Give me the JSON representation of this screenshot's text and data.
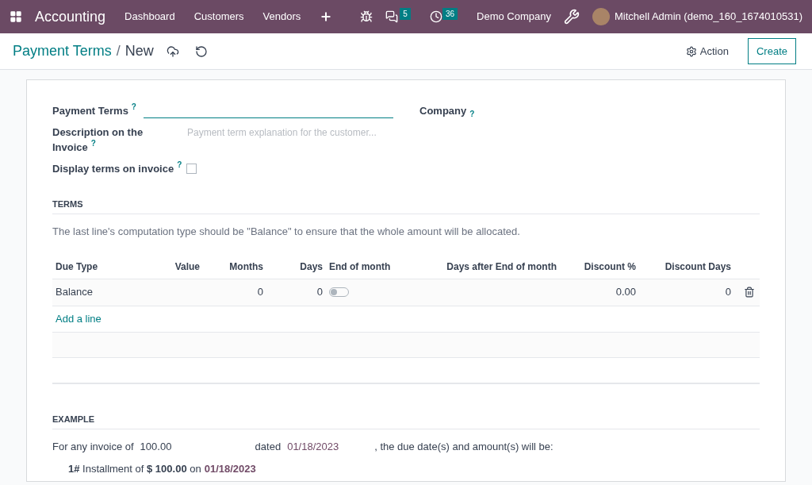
{
  "navbar": {
    "app": "Accounting",
    "menu": [
      "Dashboard",
      "Customers",
      "Vendors"
    ],
    "messages_count": "5",
    "activities_count": "36",
    "company": "Demo Company",
    "user": "Mitchell Admin (demo_160_1674010531)"
  },
  "breadcrumb": {
    "parent": "Payment Terms",
    "separator": "/",
    "current": "New"
  },
  "actions": {
    "action": "Action",
    "create": "Create"
  },
  "form": {
    "payment_terms_label": "Payment Terms",
    "description_label": "Description on the Invoice",
    "description_placeholder": "Payment term explanation for the customer...",
    "display_terms_label": "Display terms on invoice",
    "display_terms_checked": false,
    "company_label": "Company",
    "help_mark": "?"
  },
  "terms": {
    "title": "TERMS",
    "note": "The last line's computation type should be \"Balance\" to ensure that the whole amount will be allocated.",
    "columns": [
      "Due Type",
      "Value",
      "Months",
      "Days",
      "End of month",
      "Days after End of month",
      "Discount %",
      "Discount Days"
    ],
    "rows": [
      {
        "due_type": "Balance",
        "months": "0",
        "days": "0",
        "end_of_month": false,
        "discount": "0.00",
        "discount_days": "0"
      }
    ],
    "add_line": "Add a line"
  },
  "example": {
    "title": "EXAMPLE",
    "prefix": "For any invoice of",
    "amount": "100.00",
    "dated": "dated",
    "date": "01/18/2023",
    "suffix": ", the due date(s) and amount(s) will be:",
    "installments": [
      {
        "text": "**1#** Installment of **$ 100.00** on",
        "date": "01/18/2023"
      }
    ]
  }
}
